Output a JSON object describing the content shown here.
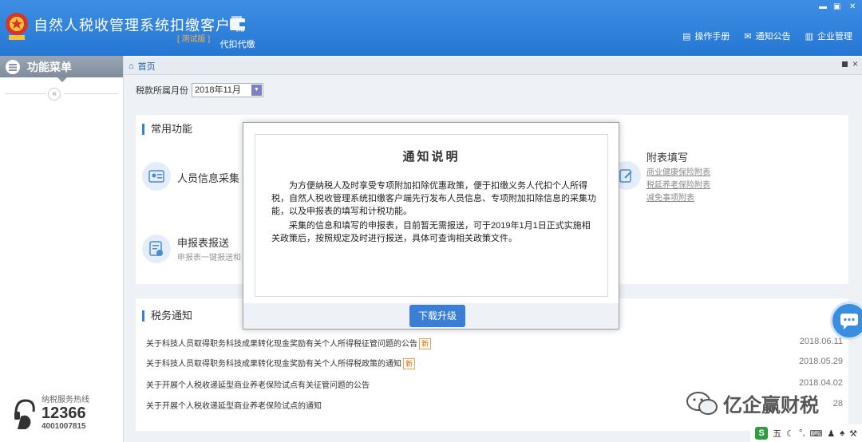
{
  "header": {
    "app_title": "自然人税收管理系统扣缴客户端",
    "edition": "[ 测试版 ]",
    "daikou_label": "代扣代缴",
    "links": [
      {
        "label": "操作手册",
        "icon": "manual-icon"
      },
      {
        "label": "通知公告",
        "icon": "mail-icon"
      },
      {
        "label": "企业管理",
        "icon": "building-icon"
      }
    ]
  },
  "sidebar": {
    "title": "功能菜单",
    "collapse_glyph": "«",
    "hotline_label": "纳税服务热线",
    "hotline_number": "12366",
    "hotline_alt": "4001007815"
  },
  "breadcrumb": {
    "home": "首页"
  },
  "month": {
    "label": "税款所属月份",
    "value": "2018年11月"
  },
  "common": {
    "title": "常用功能",
    "personnel_title": "人员信息采集",
    "report_title": "申报表报送",
    "report_desc": "申报表一键报送和",
    "attach_title": "附表填写",
    "attach_links": [
      "商业健康保险附表",
      "税延养老保险附表",
      "减免事项附表"
    ]
  },
  "tax_notice": {
    "title": "税务通知",
    "new_badge": "新",
    "items": [
      {
        "text": "关于科技人员取得职务科技成果转化现金奖励有关个人所得税征管问题的公告",
        "date": "2018.06.11",
        "is_new": true
      },
      {
        "text": "关于科技人员取得职务科技成果转化现金奖励有关个人所得税政策的通知",
        "date": "2018.05.29",
        "is_new": true
      },
      {
        "text": "关于开展个人税收递延型商业养老保险试点有关征管问题的公告",
        "date": "2018.04.02",
        "is_new": false
      },
      {
        "text": "关于开展个人税收递延型商业养老保险试点的通知",
        "date": "28",
        "is_new": false
      }
    ]
  },
  "modal": {
    "title": "通知说明",
    "para1": "为方便纳税人及时享受专项附加扣除优惠政策，便于扣缴义务人代扣个人所得税，自然人税收管理系统扣缴客户端先行发布人员信息、专项附加扣除信息的采集功能，以及申报表的填写和计税功能。",
    "para2": "采集的信息和填写的申报表，目前暂无需报送，可于2019年1月1日正式实施相关政策后，按照规定及时进行报送，具体可查询相关政策文件。",
    "button": "下载升级"
  },
  "watermark": "亿企赢财税",
  "tray": {
    "ime_label": "五"
  },
  "colors": {
    "header": "#2d80db",
    "accent": "#3a7fd5"
  }
}
